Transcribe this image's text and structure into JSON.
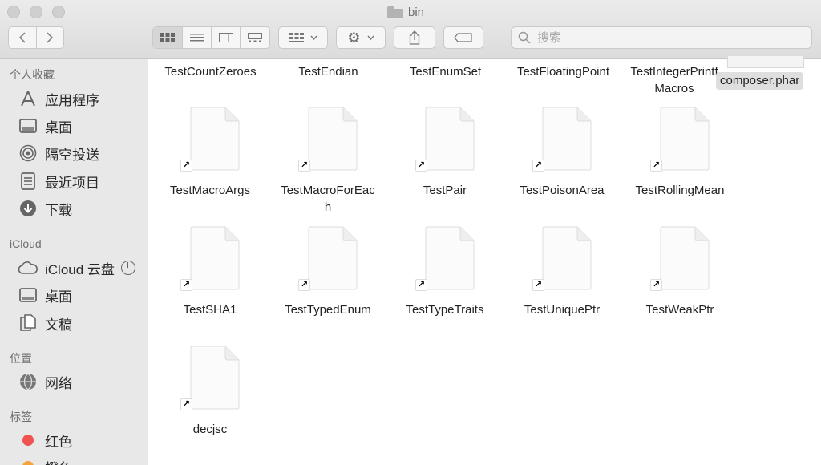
{
  "window": {
    "title": "bin"
  },
  "toolbar": {
    "back_icon": "chevron-left-icon",
    "forward_icon": "chevron-right-icon",
    "view_icons": [
      "icon-view-icon",
      "list-view-icon",
      "column-view-icon",
      "gallery-view-icon"
    ],
    "group_icon": "group-icon",
    "action_icon": "gear-icon",
    "share_icon": "share-icon",
    "tag_icon": "tag-icon",
    "search_placeholder": "搜索"
  },
  "sidebar": {
    "favorites": {
      "header": "个人收藏",
      "items": [
        {
          "label": "应用程序",
          "icon": "applications-icon"
        },
        {
          "label": "桌面",
          "icon": "desktop-icon"
        },
        {
          "label": "隔空投送",
          "icon": "airdrop-icon"
        },
        {
          "label": "最近项目",
          "icon": "recents-icon"
        },
        {
          "label": "下载",
          "icon": "downloads-icon"
        }
      ]
    },
    "icloud": {
      "header": "iCloud",
      "items": [
        {
          "label": "iCloud 云盘",
          "icon": "icloud-icon"
        },
        {
          "label": "桌面",
          "icon": "desktop-icon"
        },
        {
          "label": "文稿",
          "icon": "documents-icon"
        }
      ]
    },
    "locations": {
      "header": "位置",
      "items": [
        {
          "label": "网络",
          "icon": "network-icon"
        }
      ]
    },
    "tags": {
      "header": "标签",
      "items": [
        {
          "label": "红色",
          "color": "#f0524f"
        },
        {
          "label": "橙色",
          "color": "#f4a33a"
        }
      ]
    }
  },
  "files": {
    "top_row": [
      "TestCountZeroes",
      "TestEndian",
      "TestEnumSet",
      "TestFloatingPoint"
    ],
    "top_row_last_line1": "TestIntegerPrintf",
    "top_row_last_line2": "Macros",
    "row1": [
      {
        "name": "TestMacroArgs"
      },
      {
        "name": "TestMacroForEac",
        "name2": "h"
      },
      {
        "name": "TestPair"
      },
      {
        "name": "TestPoisonArea"
      },
      {
        "name": "TestRollingMean"
      }
    ],
    "row2": [
      {
        "name": "TestSHA1"
      },
      {
        "name": "TestTypedEnum"
      },
      {
        "name": "TestTypeTraits"
      },
      {
        "name": "TestUniquePtr"
      },
      {
        "name": "TestWeakPtr"
      }
    ],
    "row3": [
      {
        "name": "decjsc"
      }
    ],
    "selected": "composer.phar"
  }
}
